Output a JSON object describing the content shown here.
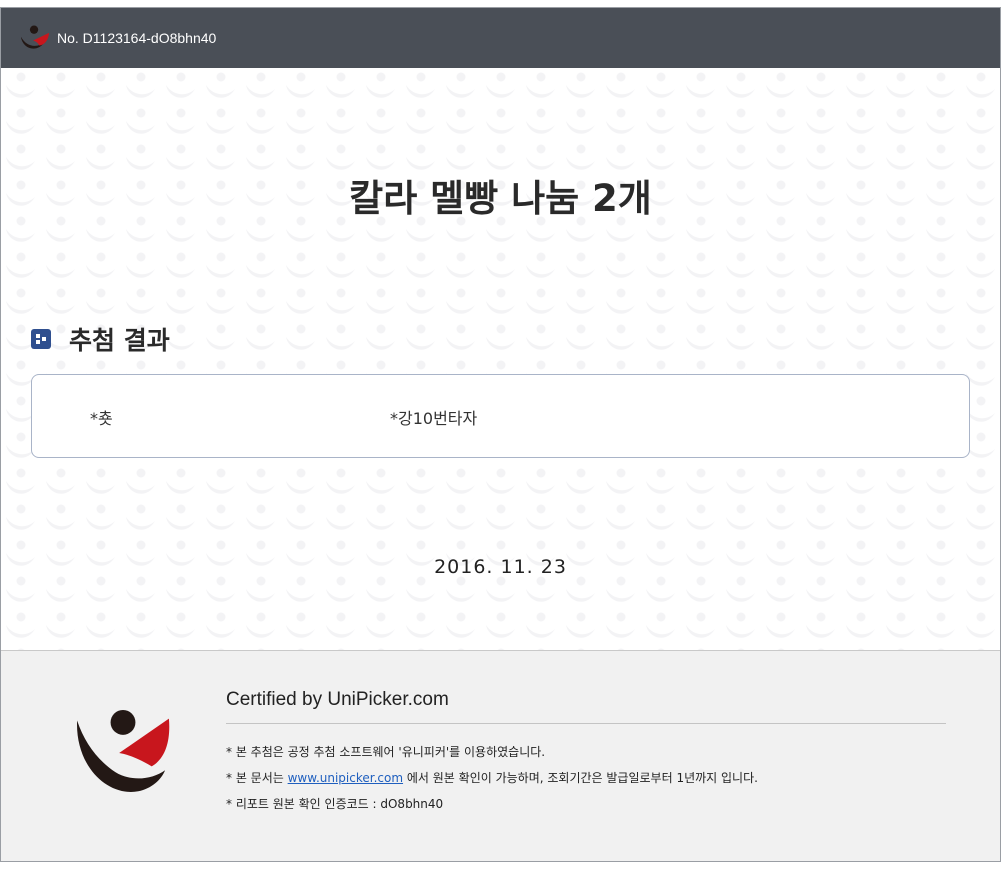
{
  "header": {
    "doc_number": "No. D1123164-dO8bhn40"
  },
  "main": {
    "title": "칼라 멜빵 나눔 2개",
    "section_label": "추첨 결과",
    "winners": [
      "*춋",
      "*강10번타자"
    ],
    "date": "2016. 11. 23"
  },
  "footer": {
    "certified_title": "Certified by UniPicker.com",
    "note1": "* 본 추첨은 공정 추첨 소프트웨어 '유니피커'를 이용하였습니다.",
    "note2_prefix": "* 본 문서는 ",
    "note2_link": "www.unipicker.com",
    "note2_suffix": " 에서 원본 확인이 가능하며, 조회기간은 발급일로부터 1년까지 입니다.",
    "note3": "* 리포트 원본 확인 인증코드 : dO8bhn40"
  },
  "colors": {
    "header_bg": "#4a4f57",
    "brand_red": "#c8161d",
    "brand_dark": "#231815",
    "section_icon_blue": "#2f4f8f",
    "link_blue": "#1f5fbf",
    "footer_bg": "#f1f1f1"
  },
  "icons": {
    "header_logo": "unipicker-logo-icon",
    "section_marker": "dice-square-icon",
    "footer_logo": "unipicker-logo-icon"
  }
}
